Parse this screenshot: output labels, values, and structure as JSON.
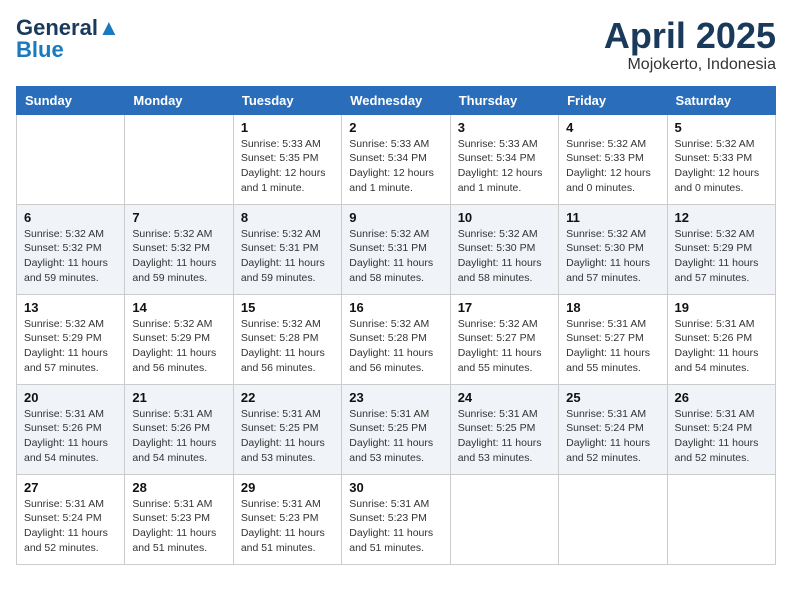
{
  "header": {
    "logo_line1": "General",
    "logo_line2": "Blue",
    "month": "April 2025",
    "location": "Mojokerto, Indonesia"
  },
  "weekdays": [
    "Sunday",
    "Monday",
    "Tuesday",
    "Wednesday",
    "Thursday",
    "Friday",
    "Saturday"
  ],
  "weeks": [
    [
      {
        "day": "",
        "info": ""
      },
      {
        "day": "",
        "info": ""
      },
      {
        "day": "1",
        "info": "Sunrise: 5:33 AM\nSunset: 5:35 PM\nDaylight: 12 hours and 1 minute."
      },
      {
        "day": "2",
        "info": "Sunrise: 5:33 AM\nSunset: 5:34 PM\nDaylight: 12 hours and 1 minute."
      },
      {
        "day": "3",
        "info": "Sunrise: 5:33 AM\nSunset: 5:34 PM\nDaylight: 12 hours and 1 minute."
      },
      {
        "day": "4",
        "info": "Sunrise: 5:32 AM\nSunset: 5:33 PM\nDaylight: 12 hours and 0 minutes."
      },
      {
        "day": "5",
        "info": "Sunrise: 5:32 AM\nSunset: 5:33 PM\nDaylight: 12 hours and 0 minutes."
      }
    ],
    [
      {
        "day": "6",
        "info": "Sunrise: 5:32 AM\nSunset: 5:32 PM\nDaylight: 11 hours and 59 minutes."
      },
      {
        "day": "7",
        "info": "Sunrise: 5:32 AM\nSunset: 5:32 PM\nDaylight: 11 hours and 59 minutes."
      },
      {
        "day": "8",
        "info": "Sunrise: 5:32 AM\nSunset: 5:31 PM\nDaylight: 11 hours and 59 minutes."
      },
      {
        "day": "9",
        "info": "Sunrise: 5:32 AM\nSunset: 5:31 PM\nDaylight: 11 hours and 58 minutes."
      },
      {
        "day": "10",
        "info": "Sunrise: 5:32 AM\nSunset: 5:30 PM\nDaylight: 11 hours and 58 minutes."
      },
      {
        "day": "11",
        "info": "Sunrise: 5:32 AM\nSunset: 5:30 PM\nDaylight: 11 hours and 57 minutes."
      },
      {
        "day": "12",
        "info": "Sunrise: 5:32 AM\nSunset: 5:29 PM\nDaylight: 11 hours and 57 minutes."
      }
    ],
    [
      {
        "day": "13",
        "info": "Sunrise: 5:32 AM\nSunset: 5:29 PM\nDaylight: 11 hours and 57 minutes."
      },
      {
        "day": "14",
        "info": "Sunrise: 5:32 AM\nSunset: 5:29 PM\nDaylight: 11 hours and 56 minutes."
      },
      {
        "day": "15",
        "info": "Sunrise: 5:32 AM\nSunset: 5:28 PM\nDaylight: 11 hours and 56 minutes."
      },
      {
        "day": "16",
        "info": "Sunrise: 5:32 AM\nSunset: 5:28 PM\nDaylight: 11 hours and 56 minutes."
      },
      {
        "day": "17",
        "info": "Sunrise: 5:32 AM\nSunset: 5:27 PM\nDaylight: 11 hours and 55 minutes."
      },
      {
        "day": "18",
        "info": "Sunrise: 5:31 AM\nSunset: 5:27 PM\nDaylight: 11 hours and 55 minutes."
      },
      {
        "day": "19",
        "info": "Sunrise: 5:31 AM\nSunset: 5:26 PM\nDaylight: 11 hours and 54 minutes."
      }
    ],
    [
      {
        "day": "20",
        "info": "Sunrise: 5:31 AM\nSunset: 5:26 PM\nDaylight: 11 hours and 54 minutes."
      },
      {
        "day": "21",
        "info": "Sunrise: 5:31 AM\nSunset: 5:26 PM\nDaylight: 11 hours and 54 minutes."
      },
      {
        "day": "22",
        "info": "Sunrise: 5:31 AM\nSunset: 5:25 PM\nDaylight: 11 hours and 53 minutes."
      },
      {
        "day": "23",
        "info": "Sunrise: 5:31 AM\nSunset: 5:25 PM\nDaylight: 11 hours and 53 minutes."
      },
      {
        "day": "24",
        "info": "Sunrise: 5:31 AM\nSunset: 5:25 PM\nDaylight: 11 hours and 53 minutes."
      },
      {
        "day": "25",
        "info": "Sunrise: 5:31 AM\nSunset: 5:24 PM\nDaylight: 11 hours and 52 minutes."
      },
      {
        "day": "26",
        "info": "Sunrise: 5:31 AM\nSunset: 5:24 PM\nDaylight: 11 hours and 52 minutes."
      }
    ],
    [
      {
        "day": "27",
        "info": "Sunrise: 5:31 AM\nSunset: 5:24 PM\nDaylight: 11 hours and 52 minutes."
      },
      {
        "day": "28",
        "info": "Sunrise: 5:31 AM\nSunset: 5:23 PM\nDaylight: 11 hours and 51 minutes."
      },
      {
        "day": "29",
        "info": "Sunrise: 5:31 AM\nSunset: 5:23 PM\nDaylight: 11 hours and 51 minutes."
      },
      {
        "day": "30",
        "info": "Sunrise: 5:31 AM\nSunset: 5:23 PM\nDaylight: 11 hours and 51 minutes."
      },
      {
        "day": "",
        "info": ""
      },
      {
        "day": "",
        "info": ""
      },
      {
        "day": "",
        "info": ""
      }
    ]
  ]
}
